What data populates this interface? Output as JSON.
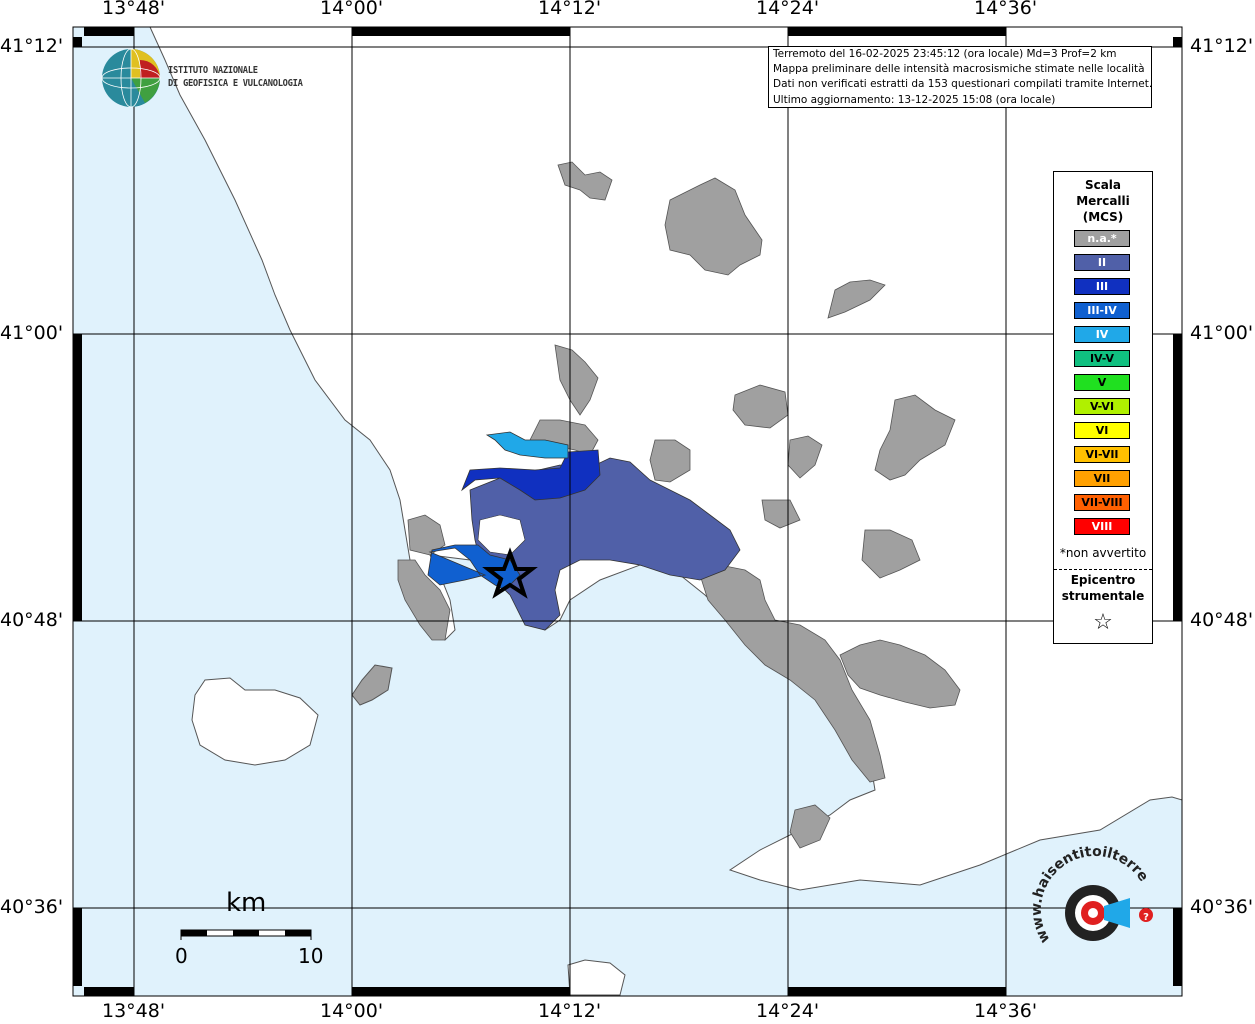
{
  "axes": {
    "top_labels": [
      "13°48'",
      "14°00'",
      "14°12'",
      "14°24'",
      "14°36'"
    ],
    "bottom_labels": [
      "13°48'",
      "14°00'",
      "14°12'",
      "14°24'",
      "14°36'"
    ],
    "left_labels": [
      "41°12'",
      "41°00'",
      "40°48'",
      "40°36'"
    ],
    "right_labels": [
      "41°12'",
      "41°00'",
      "40°48'",
      "40°36'"
    ]
  },
  "logo": {
    "name": "ingv-logo-icon",
    "line1": "ISTITUTO NAZIONALE",
    "line2": "DI GEOFISICA E VULCANOLOGIA"
  },
  "info": {
    "line1": "Terremoto del 16-02-2025 23:45:12 (ora locale) Md=3 Prof=2 km",
    "line2": "Mappa preliminare delle intensità macrosismiche stimate nelle località",
    "line3": "Dati non verificati estratti da 153 questionari compilati tramite Internet.",
    "line4": "Ultimo aggiornamento: 13-12-2025 15:08 (ora locale)"
  },
  "legend": {
    "title1": "Scala",
    "title2": "Mercalli",
    "title3": "(MCS)",
    "items": [
      {
        "label": "n.a.*",
        "color": "#a0a0a0",
        "text_color": "#ffffff"
      },
      {
        "label": "II",
        "color": "#5060a8",
        "text_color": "#ffffff"
      },
      {
        "label": "III",
        "color": "#1030c0",
        "text_color": "#ffffff"
      },
      {
        "label": "III-IV",
        "color": "#1060d0",
        "text_color": "#ffffff"
      },
      {
        "label": "IV",
        "color": "#20a8e8",
        "text_color": "#ffffff"
      },
      {
        "label": "IV-V",
        "color": "#10c080",
        "text_color": "#000000"
      },
      {
        "label": "V",
        "color": "#20e020",
        "text_color": "#000000"
      },
      {
        "label": "V-VI",
        "color": "#b0f000",
        "text_color": "#000000"
      },
      {
        "label": "VI",
        "color": "#ffff00",
        "text_color": "#000000"
      },
      {
        "label": "VI-VII",
        "color": "#ffc000",
        "text_color": "#000000"
      },
      {
        "label": "VII",
        "color": "#ffa000",
        "text_color": "#000000"
      },
      {
        "label": "VII-VIII",
        "color": "#ff6000",
        "text_color": "#000000"
      },
      {
        "label": "VIII",
        "color": "#ff0000",
        "text_color": "#ffffff"
      }
    ],
    "note": "*non avvertito",
    "epicenter1": "Epicentro",
    "epicenter2": "strumentale",
    "epicenter_symbol": "☆"
  },
  "scale_bar": {
    "unit": "km",
    "start": "0",
    "end": "10"
  },
  "watermark": {
    "name": "haisentito-logo-icon",
    "text": "www.haisentitoilterremoto.it"
  },
  "colors": {
    "sea": "#e0f2fc",
    "land": "#ffffff",
    "na": "#a0a0a0",
    "ii": "#5060a8",
    "iii": "#1030c0",
    "iii_iv": "#1060d0",
    "iv": "#20a8e8"
  }
}
